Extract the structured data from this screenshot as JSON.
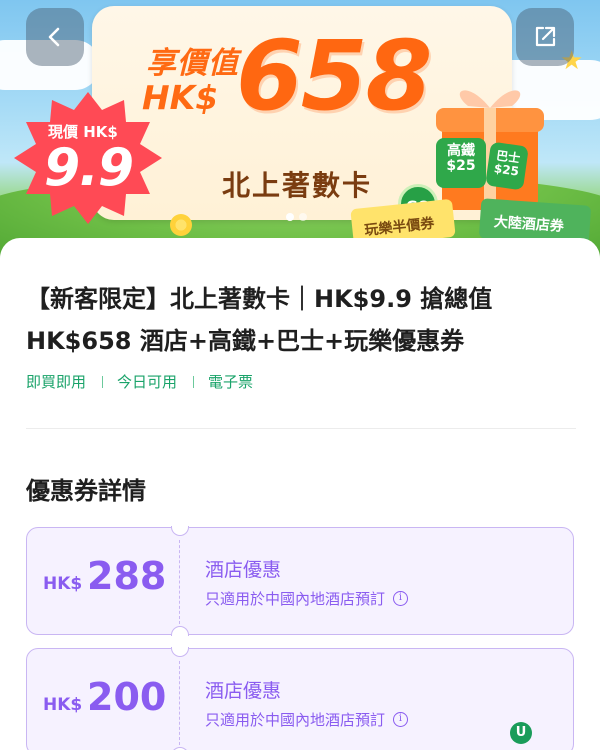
{
  "hero": {
    "enjoy_label": "享價值",
    "enjoy_currency": "HK$",
    "value_amount": "658",
    "product_name": "北上著數卡",
    "current_price_label": "現價 HK$",
    "current_price": "9.9",
    "ticket_rail": "高鐵\n$25",
    "ticket_bus": "巴士\n$25",
    "go_badge": "GO",
    "strip_play": "玩樂半價券",
    "strip_hotel": "大陸酒店券",
    "page_dots": 2,
    "active_dot": 1
  },
  "nav": {
    "back_icon": "chevron-left-icon",
    "share_icon": "share-external-icon"
  },
  "product": {
    "title": "【新客限定】北上著數卡｜HK$9.9 搶總值 HK$658 酒店+高鐵+巴士+玩樂優惠券",
    "tags": [
      "即買即用",
      "今日可用",
      "電子票"
    ]
  },
  "details": {
    "section_title": "優惠券詳情",
    "coupons": [
      {
        "currency": "HK$",
        "amount": "288",
        "title": "酒店優惠",
        "description": "只適用於中國內地酒店預訂"
      },
      {
        "currency": "HK$",
        "amount": "200",
        "title": "酒店優惠",
        "description": "只適用於中國內地酒店預訂"
      }
    ]
  },
  "colors": {
    "accent_orange": "#ff6711",
    "tag_green": "#1aa36a",
    "coupon_purple": "#8a5cf0"
  }
}
